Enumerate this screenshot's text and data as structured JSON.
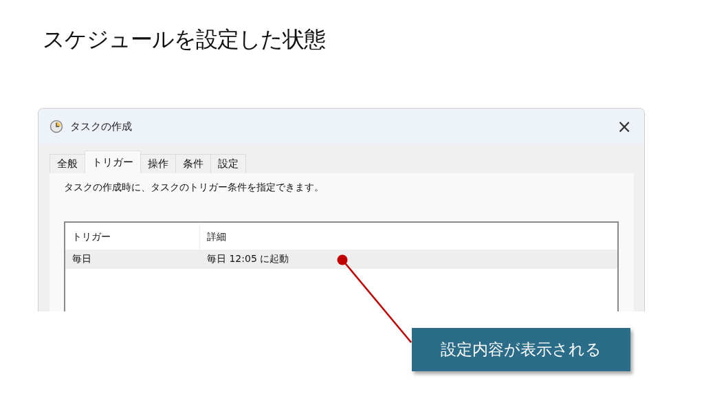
{
  "slide_title": "スケジュールを設定した状態",
  "window": {
    "title": "タスクの作成",
    "close": "×"
  },
  "tabs": [
    {
      "label": "全般",
      "selected": false
    },
    {
      "label": "トリガー",
      "selected": true
    },
    {
      "label": "操作",
      "selected": false
    },
    {
      "label": "条件",
      "selected": false
    },
    {
      "label": "設定",
      "selected": false
    }
  ],
  "description": "タスクの作成時に、タスクのトリガー条件を指定できます。",
  "table": {
    "columns": [
      "トリガー",
      "詳細"
    ],
    "rows": [
      {
        "cells": [
          "毎日",
          "毎日 12:05 に起動"
        ],
        "selected": true
      }
    ]
  },
  "callout": {
    "text": "設定内容が表示される"
  }
}
